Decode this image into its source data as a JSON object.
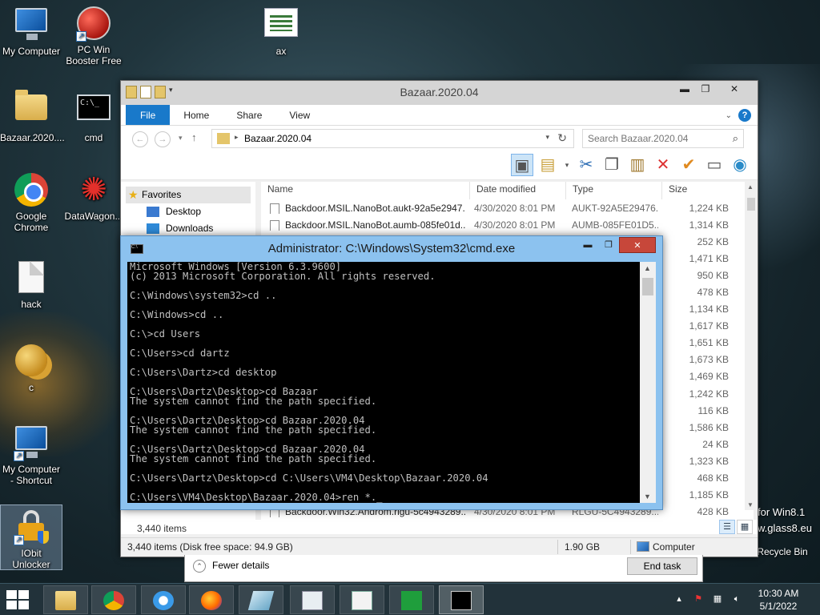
{
  "desktop": {
    "icons": [
      {
        "label": "My Computer"
      },
      {
        "label": "PC Win Booster Free"
      },
      {
        "label": "ax"
      },
      {
        "label": "Bazaar.2020...."
      },
      {
        "label": "cmd"
      },
      {
        "label": "Google Chrome"
      },
      {
        "label": "DataWagon..."
      },
      {
        "label": "hack"
      },
      {
        "label": "c"
      },
      {
        "label": "My Computer - Shortcut"
      },
      {
        "label": "IObit Unlocker"
      }
    ],
    "watermark_line1": "for Win8.1",
    "watermark_line2": "w.glass8.eu",
    "recycle_bin": "Recycle Bin"
  },
  "explorer": {
    "title": "Bazaar.2020.04",
    "tabs": [
      "File",
      "Home",
      "Share",
      "View"
    ],
    "address": "Bazaar.2020.04",
    "search_placeholder": "Search Bazaar.2020.04",
    "nav": {
      "favorites": "Favorites",
      "desktop": "Desktop",
      "downloads": "Downloads"
    },
    "columns": {
      "name": "Name",
      "date": "Date modified",
      "type": "Type",
      "size": "Size"
    },
    "rows": [
      {
        "name": "Backdoor.MSIL.NanoBot.aukt-92a5e2947...",
        "date": "4/30/2020 8:01 PM",
        "type": "AUKT-92A5E29476...",
        "size": "1,224 KB"
      },
      {
        "name": "Backdoor.MSIL.NanoBot.aumb-085fe01d...",
        "date": "4/30/2020 8:01 PM",
        "type": "AUMB-085FE01D5...",
        "size": "1,314 KB"
      },
      {
        "name": "",
        "date": "",
        "type": "",
        "size": "252 KB"
      },
      {
        "name": "",
        "date": "",
        "type": "",
        "size": "1,471 KB"
      },
      {
        "name": "",
        "date": "",
        "type": "",
        "size": "950 KB"
      },
      {
        "name": "",
        "date": "",
        "type": "",
        "size": "478 KB"
      },
      {
        "name": "",
        "date": "",
        "type": "",
        "size": "1,134 KB"
      },
      {
        "name": "",
        "date": "",
        "type": "",
        "size": "1,617 KB"
      },
      {
        "name": "",
        "date": "",
        "type": "",
        "size": "1,651 KB"
      },
      {
        "name": "",
        "date": "",
        "type": "",
        "size": "1,673 KB"
      },
      {
        "name": "",
        "date": "",
        "type": "",
        "size": "1,469 KB"
      },
      {
        "name": "",
        "date": "",
        "type": "",
        "size": "1,242 KB"
      },
      {
        "name": "",
        "date": "",
        "type": "",
        "size": "116 KB"
      },
      {
        "name": "",
        "date": "",
        "type": "",
        "size": "1,586 KB"
      },
      {
        "name": "",
        "date": "",
        "type": "",
        "size": "24 KB"
      },
      {
        "name": "",
        "date": "",
        "type": "",
        "size": "1,323 KB"
      },
      {
        "name": "",
        "date": "",
        "type": "",
        "size": "468 KB"
      },
      {
        "name": "",
        "date": "",
        "type": "",
        "size": "1,185 KB"
      },
      {
        "name": "Backdoor.Win32.Androm.rlgu-5c4943289...",
        "date": "4/30/2020 8:01 PM",
        "type": "RLGU-5C4943289...",
        "size": "428 KB"
      }
    ],
    "item_count": "3,440 items",
    "details_free": "3,440 items (Disk free space: 94.9 GB)",
    "details_size": "1.90 GB",
    "details_computer": "Computer"
  },
  "task_manager": {
    "fewer_details": "Fewer details",
    "end_task": "End task"
  },
  "cmd": {
    "title": "Administrator: C:\\Windows\\System32\\cmd.exe",
    "output": "Microsoft Windows [Version 6.3.9600]\n(c) 2013 Microsoft Corporation. All rights reserved.\n\nC:\\Windows\\system32>cd ..\n\nC:\\Windows>cd ..\n\nC:\\>cd Users\n\nC:\\Users>cd dartz\n\nC:\\Users\\Dartz>cd desktop\n\nC:\\Users\\Dartz\\Desktop>cd Bazaar\nThe system cannot find the path specified.\n\nC:\\Users\\Dartz\\Desktop>cd Bazaar.2020.04\nThe system cannot find the path specified.\n\nC:\\Users\\Dartz\\Desktop>cd Bazaar.2020.04\nThe system cannot find the path specified.\n\nC:\\Users\\Dartz\\Desktop>cd C:\\Users\\VM4\\Desktop\\Bazaar.2020.04\n\nC:\\Users\\VM4\\Desktop\\Bazaar.2020.04>ren *._"
  },
  "taskbar": {
    "time": "10:30 AM",
    "date": "5/1/2022"
  },
  "colors": {
    "file_tab": "#1979ca",
    "cmd_frame": "#8cc2ef",
    "close_button": "#c7473a"
  }
}
